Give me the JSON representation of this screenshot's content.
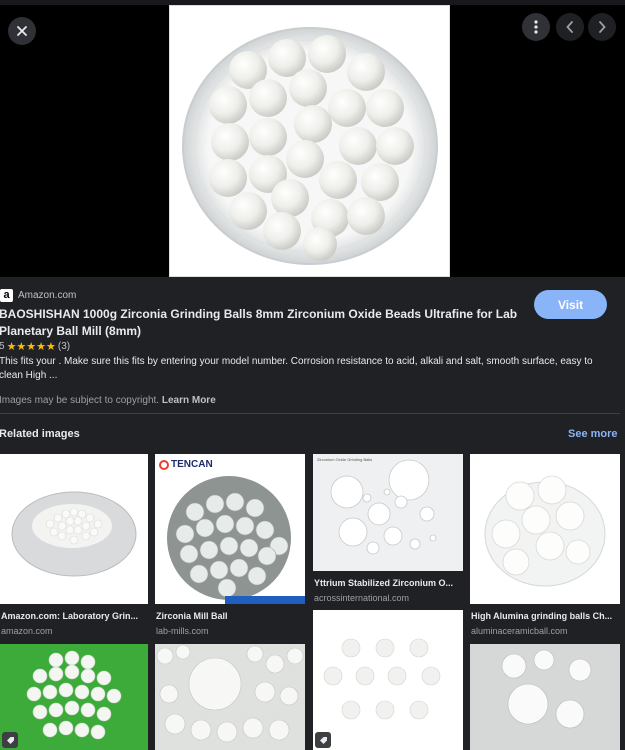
{
  "viewer": {
    "close_label": "×",
    "more_label": "⋮",
    "prev_label": "‹",
    "next_label": "›"
  },
  "result": {
    "source": "Amazon.com",
    "source_logo_letter": "a",
    "visit_label": "Visit",
    "title": "BAOSHISHAN 1000g Zirconia Grinding Balls 8mm Zirconium Oxide Beads Ultrafine for Lab Planetary Ball Mill (8mm)",
    "rating_value": "5",
    "stars": "★★★★★",
    "rating_count": "(3)",
    "description": "This fits your . Make sure this fits by entering your model number. Corrosion resistance to acid, alkali and salt, smooth surface, easy to clean High ...",
    "copyright_text": "Images may be subject to copyright.",
    "learn_more": "Learn More"
  },
  "related": {
    "heading": "Related images",
    "see_more": "See more",
    "items": [
      {
        "caption": "Amazon.com: Laboratory Grin...",
        "domain": "amazon.com"
      },
      {
        "caption": "Zirconia Mill Ball",
        "domain": "lab-mills.com",
        "brand": "TENCAN"
      },
      {
        "caption": "Yttrium Stabilized Zirconium O...",
        "domain": "acrossinternational.com",
        "inner_title": "Zirconium Oxide Grinding Balls"
      },
      {
        "caption": "High Alumina grinding balls Ch...",
        "domain": "aluminaceramicball.com"
      }
    ]
  },
  "colors": {
    "accent": "#8ab4f8",
    "panel_bg": "#202124",
    "star": "#fbbc04"
  }
}
